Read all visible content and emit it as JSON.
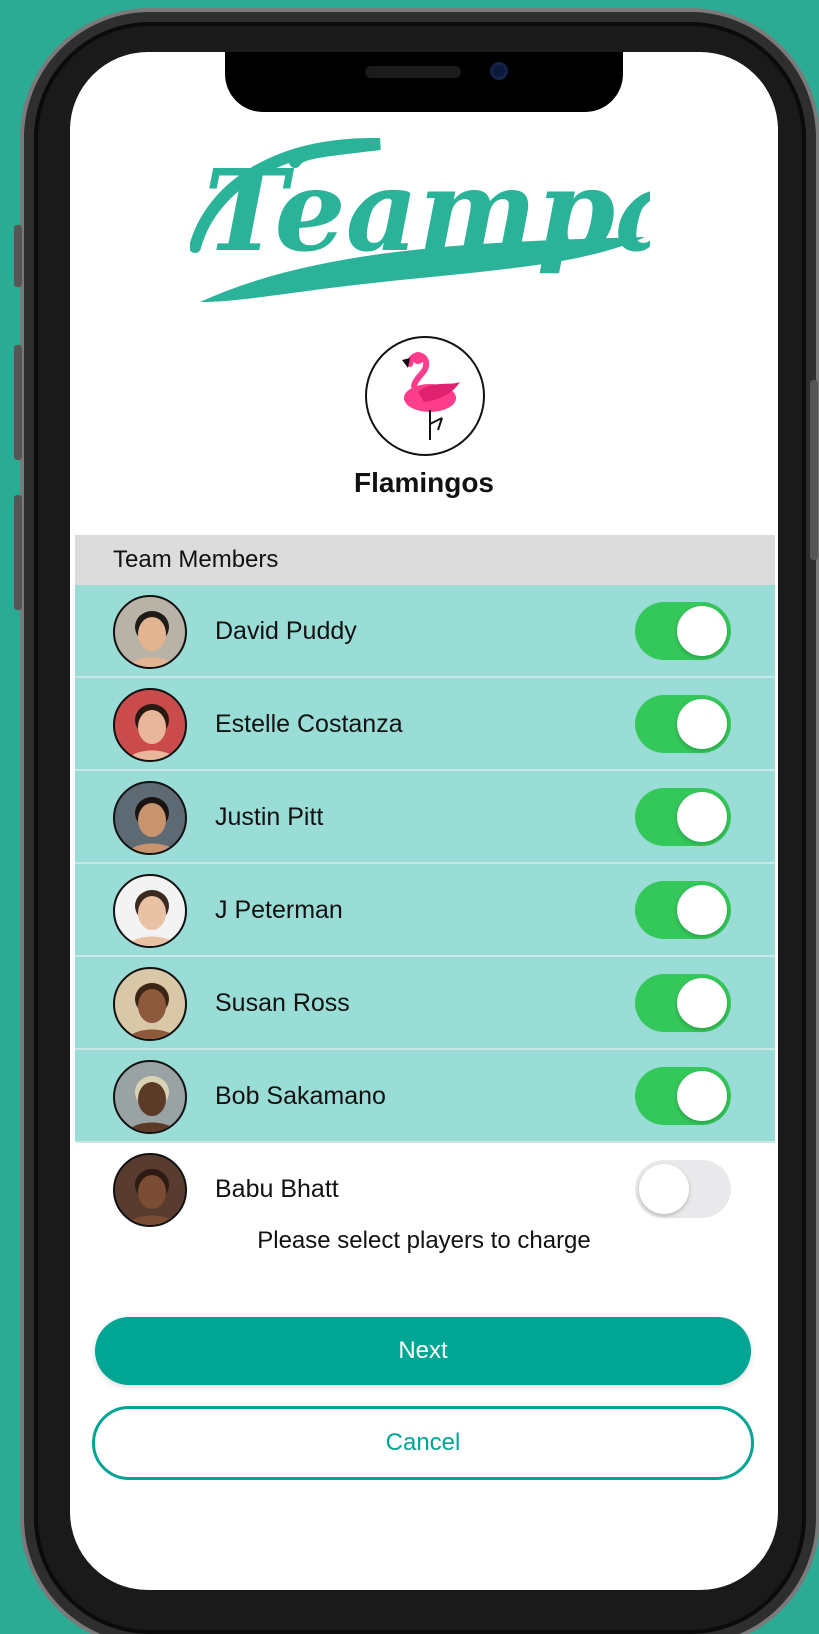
{
  "app": {
    "brand": "Teampay",
    "accent_color": "#00a594",
    "background_color": "#2bab94"
  },
  "team": {
    "name": "Flamingos",
    "avatar_icon": "flamingo-icon"
  },
  "members_section": {
    "header": "Team Members",
    "members": [
      {
        "name": "David Puddy",
        "selected": true,
        "skin": "#e2b491",
        "hair": "#1e1a18",
        "bg": "#b9b2a6"
      },
      {
        "name": "Estelle Costanza",
        "selected": true,
        "skin": "#e8b69a",
        "hair": "#2b1a14",
        "bg": "#c94b4b"
      },
      {
        "name": "Justin Pitt",
        "selected": true,
        "skin": "#c89470",
        "hair": "#1a1410",
        "bg": "#5d6a74"
      },
      {
        "name": "J Peterman",
        "selected": true,
        "skin": "#e9c2a6",
        "hair": "#3a2a20",
        "bg": "#f3f3f3"
      },
      {
        "name": "Susan Ross",
        "selected": true,
        "skin": "#8d5b3c",
        "hair": "#3b2414",
        "bg": "#d9c8a8"
      },
      {
        "name": "Bob Sakamano",
        "selected": true,
        "skin": "#5b3a27",
        "hair": "#d9d3b6",
        "bg": "#9aa3a3"
      },
      {
        "name": "Babu Bhatt",
        "selected": false,
        "skin": "#7a4c34",
        "hair": "#2b1b12",
        "bg": "#5a3b30"
      }
    ]
  },
  "prompt": "Please select players to charge",
  "buttons": {
    "next": "Next",
    "cancel": "Cancel"
  }
}
